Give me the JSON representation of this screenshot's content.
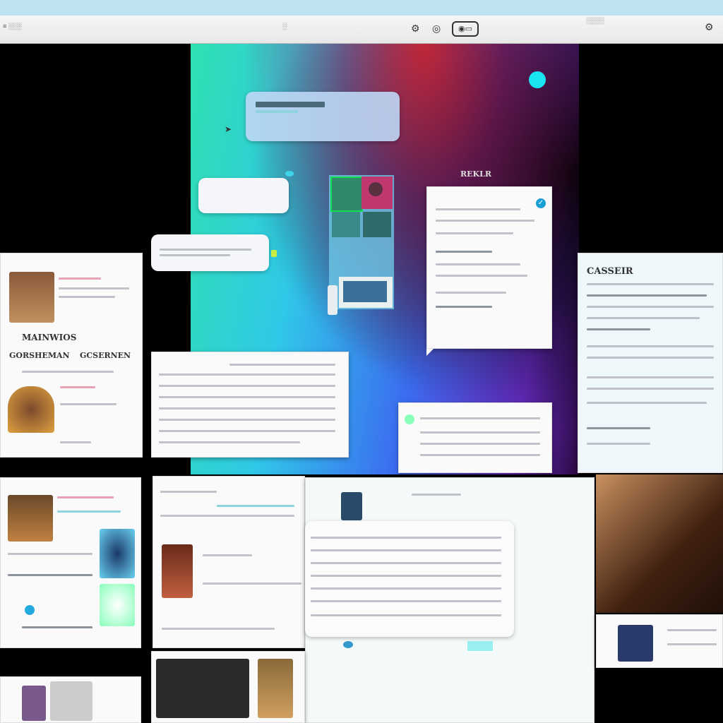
{
  "topbar": {
    "left_text": "≡ ░░░",
    "mid_text": "░",
    "right_text": "░░░░",
    "icons": [
      "gear-icon",
      "target-icon",
      "camera-icon",
      "settings-icon"
    ]
  },
  "hero": {
    "label": "REKLR",
    "accent_color": "#19e5f2"
  },
  "cards": {
    "left_top": {
      "title": "MAINWIOS",
      "subtitle": "GORSHEMAN",
      "subtitle2": "GCSERNEN"
    },
    "right_tall": {
      "title": "CASSEIR"
    }
  }
}
